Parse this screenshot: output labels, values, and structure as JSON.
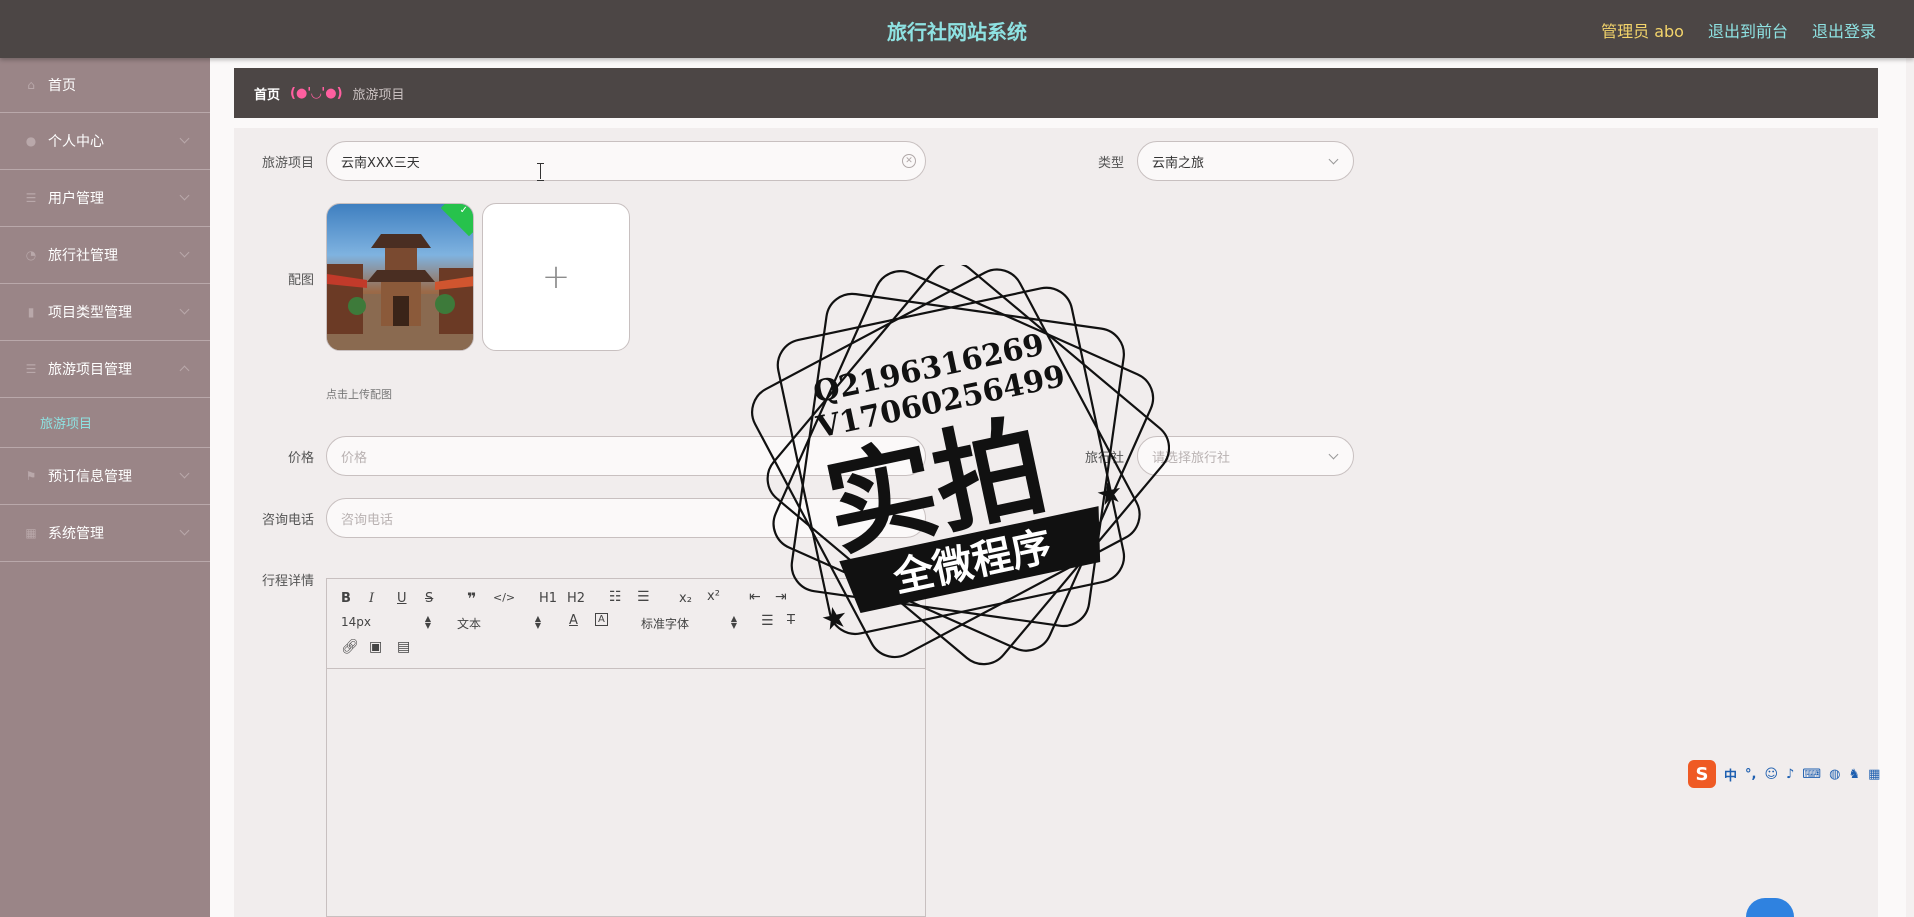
{
  "header": {
    "title": "旅行社网站系统",
    "admin_label": "管理员 abo",
    "to_front_label": "退出到前台",
    "logout_label": "退出登录"
  },
  "sidebar": {
    "items": [
      {
        "label": "首页",
        "icon": "home-icon"
      },
      {
        "label": "个人中心",
        "icon": "user-icon"
      },
      {
        "label": "用户管理",
        "icon": "list-icon"
      },
      {
        "label": "旅行社管理",
        "icon": "pin-icon"
      },
      {
        "label": "项目类型管理",
        "icon": "chart-icon"
      },
      {
        "label": "旅游项目管理",
        "icon": "list-icon"
      },
      {
        "label": "预订信息管理",
        "icon": "flag-icon"
      },
      {
        "label": "系统管理",
        "icon": "grid-icon"
      }
    ],
    "submenu_active": "旅游项目"
  },
  "breadcrumb": {
    "home": "首页",
    "face": "(●'◡'●)",
    "current": "旅游项目"
  },
  "form": {
    "project_label": "旅游项目",
    "project_value": "云南XXX三天",
    "type_label": "类型",
    "type_value": "云南之旅",
    "image_label": "配图",
    "upload_hint": "点击上传配图",
    "price_label": "价格",
    "price_placeholder": "价格",
    "agency_label": "旅行社",
    "agency_placeholder": "请选择旅行社",
    "phone_label": "咨询电话",
    "phone_placeholder": "咨询电话",
    "detail_label": "行程详情"
  },
  "editor": {
    "font_size": "14px",
    "paragraph": "文本",
    "font_family": "标准字体",
    "btn_h1": "H1",
    "btn_h2": "H2"
  },
  "watermark": {
    "line1": "Q2196316269",
    "line2": "V17060256499",
    "big_text": "实拍",
    "banner_text": "全微程序"
  },
  "ime": {
    "logo": "S",
    "mode": "中"
  },
  "colors": {
    "header_bg": "#4c4645",
    "sidebar_bg": "#9a8587",
    "accent": "#8ee2e2",
    "admin": "#f3d46b"
  }
}
